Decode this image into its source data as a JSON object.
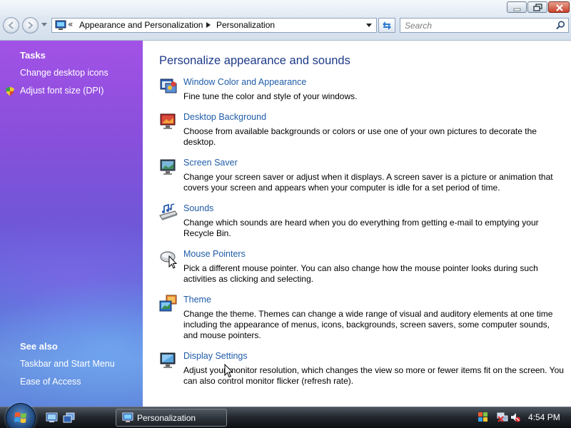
{
  "address_bar": {
    "chevron": "«",
    "crumbs": [
      "Appearance and Personalization",
      "Personalization"
    ],
    "icon": "control-panel-icon"
  },
  "search": {
    "placeholder": "Search"
  },
  "left_pane": {
    "tasks_heading": "Tasks",
    "tasks": [
      {
        "label": "Change desktop icons"
      },
      {
        "label": "Adjust font size (DPI)",
        "icon": "shield-icon"
      }
    ],
    "see_also_heading": "See also",
    "see_also": [
      {
        "label": "Taskbar and Start Menu"
      },
      {
        "label": "Ease of Access"
      }
    ]
  },
  "main": {
    "title": "Personalize appearance and sounds",
    "categories": [
      {
        "link": "Window Color and Appearance",
        "desc": "Fine tune the color and style of your windows.",
        "icon": "window-color-icon"
      },
      {
        "link": "Desktop Background",
        "desc": "Choose from available backgrounds or colors or use one of your own pictures to decorate the desktop.",
        "icon": "desktop-background-icon"
      },
      {
        "link": "Screen Saver",
        "desc": "Change your screen saver or adjust when it displays. A screen saver is a picture or animation that covers your screen and appears when your computer is idle for a set period of time.",
        "icon": "screen-saver-icon"
      },
      {
        "link": "Sounds",
        "desc": "Change which sounds are heard when you do everything from getting e-mail to emptying your Recycle Bin.",
        "icon": "sounds-icon"
      },
      {
        "link": "Mouse Pointers",
        "desc": "Pick a different mouse pointer. You can also change how the mouse pointer looks during such activities as clicking and selecting.",
        "icon": "mouse-pointers-icon"
      },
      {
        "link": "Theme",
        "desc": "Change the theme. Themes can change a wide range of visual and auditory elements at one time including the appearance of menus, icons, backgrounds, screen savers, some computer sounds, and mouse pointers.",
        "icon": "theme-icon"
      },
      {
        "link": "Display Settings",
        "desc": "Adjust your monitor resolution, which changes the view so more or fewer items fit on the screen. You can also control monitor flicker (refresh rate).",
        "icon": "display-settings-icon"
      }
    ]
  },
  "taskbar": {
    "start_icon": "windows-orb-icon",
    "quick_launch": [
      "show-desktop-icon",
      "switch-windows-icon"
    ],
    "window_button": {
      "label": "Personalization",
      "icon": "personalization-icon"
    },
    "tray_icons": [
      "windows-update-icon",
      "network-icon",
      "volume-icon"
    ],
    "clock": "4:54 PM"
  },
  "colors": {
    "link_blue": "#1f5ca8",
    "heading_blue": "#1e3a8a",
    "left_pane_top": "#a252e6",
    "left_pane_bottom": "#5f86dc"
  }
}
